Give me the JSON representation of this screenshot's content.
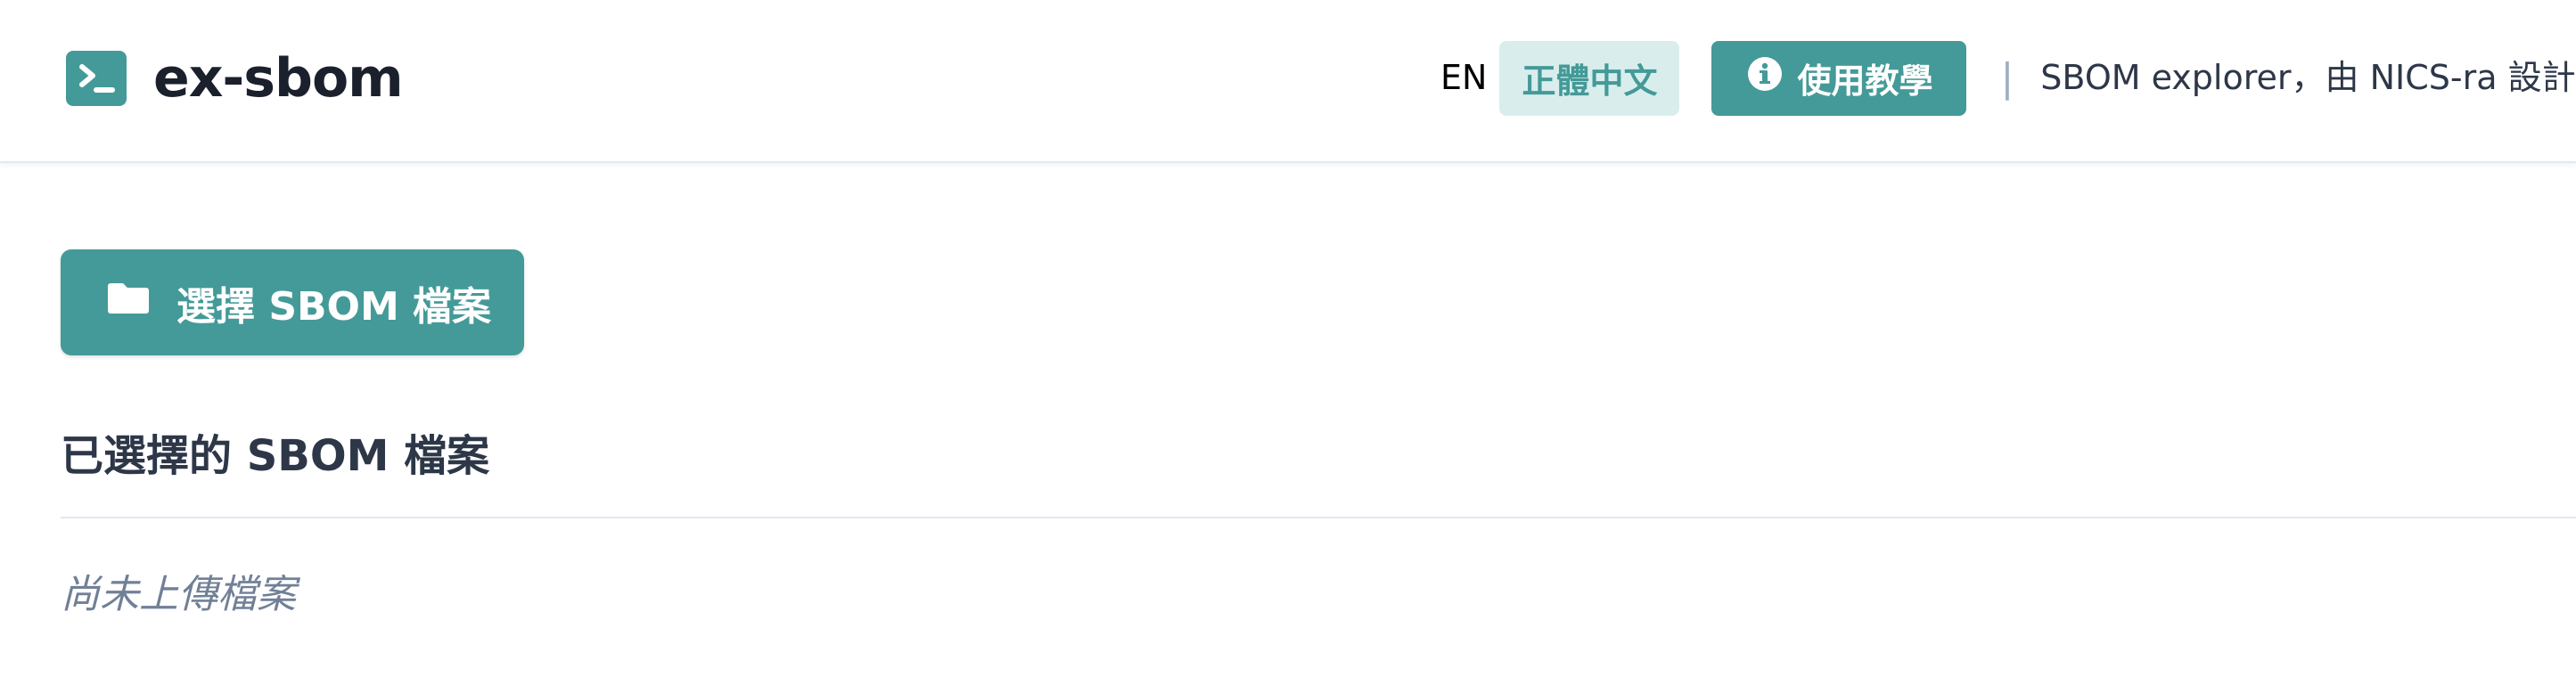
{
  "header": {
    "logo_icon": "terminal-icon",
    "brand_title": "ex-sbom",
    "lang_en": "EN",
    "lang_zh": "正體中文",
    "tutorial_icon": "info-circle-icon",
    "tutorial_label": "使用教學",
    "divider": "|",
    "tagline": "SBOM explorer，由 NICS-ra 設計"
  },
  "main": {
    "select_icon": "folder-icon",
    "select_button_label": "選擇 SBOM 檔案",
    "section_title": "已選擇的 SBOM 檔案",
    "empty_message": "尚未上傳檔案"
  },
  "colors": {
    "accent": "#449a98",
    "accent_light": "#d9eeec",
    "text_dark": "#1a202c",
    "text_muted": "#718096"
  }
}
